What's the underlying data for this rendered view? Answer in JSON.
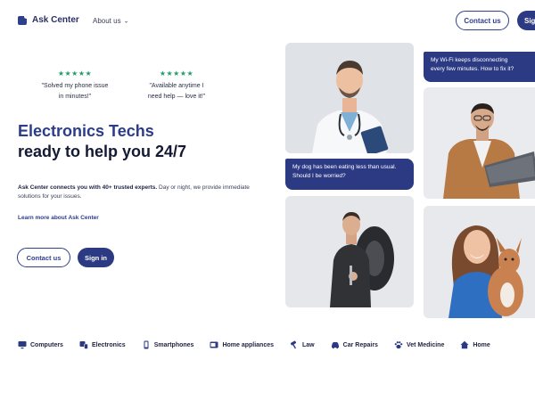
{
  "header": {
    "logo_text": "Ask Center",
    "logo_icon": "chat-bubble-icon",
    "nav_about_label": "About us",
    "contact_label": "Contact us",
    "signin_label": "Sign in"
  },
  "testimonials": [
    {
      "stars": "★★★★★",
      "line1": "\"Solved my phone issue",
      "line2": "in minutes!\""
    },
    {
      "stars": "★★★★★",
      "line1": "\"Available anytime I",
      "line2": "need help — love it!\""
    }
  ],
  "hero": {
    "title_line1": "Electronics Techs",
    "title_line2": "ready to help you 24/7",
    "desc_strong": "Ask Center connects you with 40+ trusted experts.",
    "desc_rest": " Day or night, we provide immediate solutions for your issues.",
    "learn_more": "Learn more about Ask Center",
    "contact_label": "Contact us",
    "signin_label": "Sign in"
  },
  "bubbles": {
    "dog_text": "My dog has been eating less than usual. Should I be worried?",
    "wifi_line1": "My Wi-Fi keeps disconnecting",
    "wifi_line2": "every few minutes. How to fix it?"
  },
  "categories": [
    {
      "label": "Computers",
      "icon": "monitor-icon"
    },
    {
      "label": "Electronics",
      "icon": "devices-icon"
    },
    {
      "label": "Smartphones",
      "icon": "smartphone-icon"
    },
    {
      "label": "Home appliances",
      "icon": "appliance-icon"
    },
    {
      "label": "Law",
      "icon": "gavel-icon"
    },
    {
      "label": "Car Repairs",
      "icon": "car-icon"
    },
    {
      "label": "Vet Medicine",
      "icon": "paw-icon"
    },
    {
      "label": "Home",
      "icon": "home-icon"
    }
  ],
  "colors": {
    "brand": "#2c3a84",
    "stars": "#1e9e6a",
    "heading_dark": "#141a33"
  }
}
